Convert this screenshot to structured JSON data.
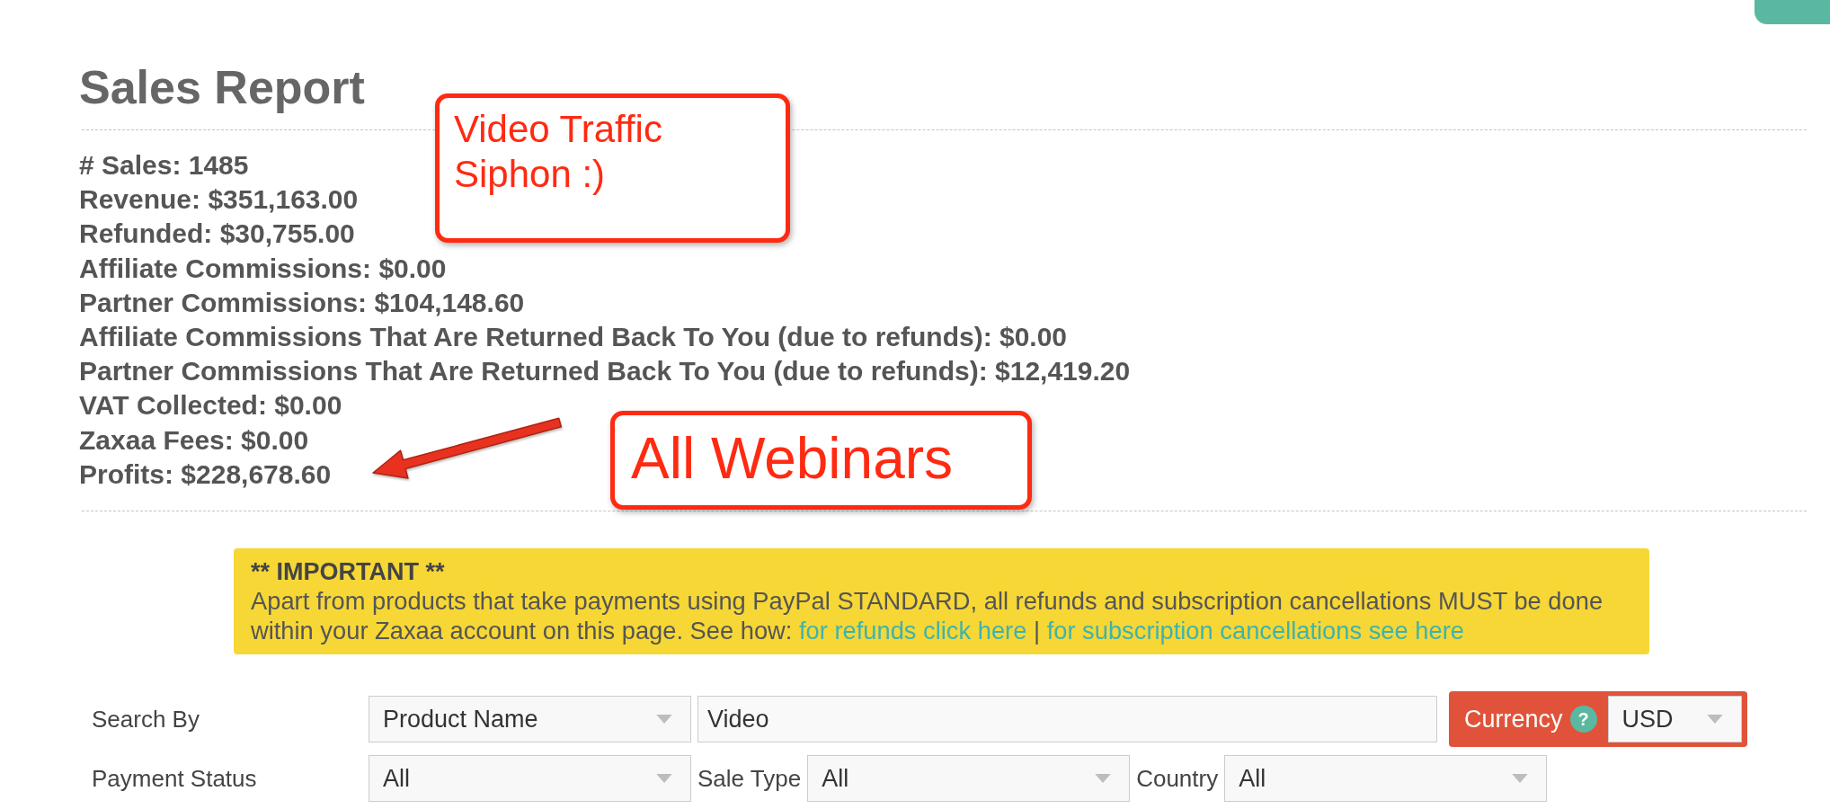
{
  "title": "Sales Report",
  "annotations": [
    {
      "kind": "note",
      "text": "Video Traffic Siphon :)"
    },
    {
      "kind": "arrow"
    },
    {
      "kind": "note",
      "text": "All Webinars"
    }
  ],
  "stats": [
    "# Sales: 1485",
    "Revenue: $351,163.00",
    "Refunded: $30,755.00",
    "Affiliate Commissions: $0.00",
    "Partner Commissions: $104,148.60",
    "Affiliate Commissions That Are Returned Back To You (due to refunds): $0.00",
    "Partner Commissions That Are Returned Back To You (due to refunds): $12,419.20",
    "VAT Collected: $0.00",
    "Zaxaa Fees: $0.00",
    "Profits: $228,678.60"
  ],
  "notice": {
    "heading": "** IMPORTANT **",
    "text": "Apart from products that take payments using PayPal STANDARD, all refunds and subscription cancellations MUST be done within your Zaxaa account on this page. See how:",
    "links": [
      "for refunds click here",
      "for subscription cancellations see here"
    ],
    "separator": "|"
  },
  "filters": [
    {
      "items": [
        {
          "kind": "label",
          "text": "Search By"
        },
        {
          "kind": "select",
          "value": "Product Name"
        },
        {
          "kind": "input",
          "value": "Video"
        },
        {
          "kind": "currency",
          "label": "Currency",
          "help": "?",
          "value": "USD"
        }
      ]
    },
    {
      "items": [
        {
          "kind": "label",
          "text": "Payment Status"
        },
        {
          "kind": "select",
          "value": "All"
        },
        {
          "kind": "label",
          "text": "Sale Type"
        },
        {
          "kind": "select",
          "value": "All"
        },
        {
          "kind": "label",
          "text": "Country"
        },
        {
          "kind": "select",
          "value": "All"
        }
      ]
    }
  ]
}
